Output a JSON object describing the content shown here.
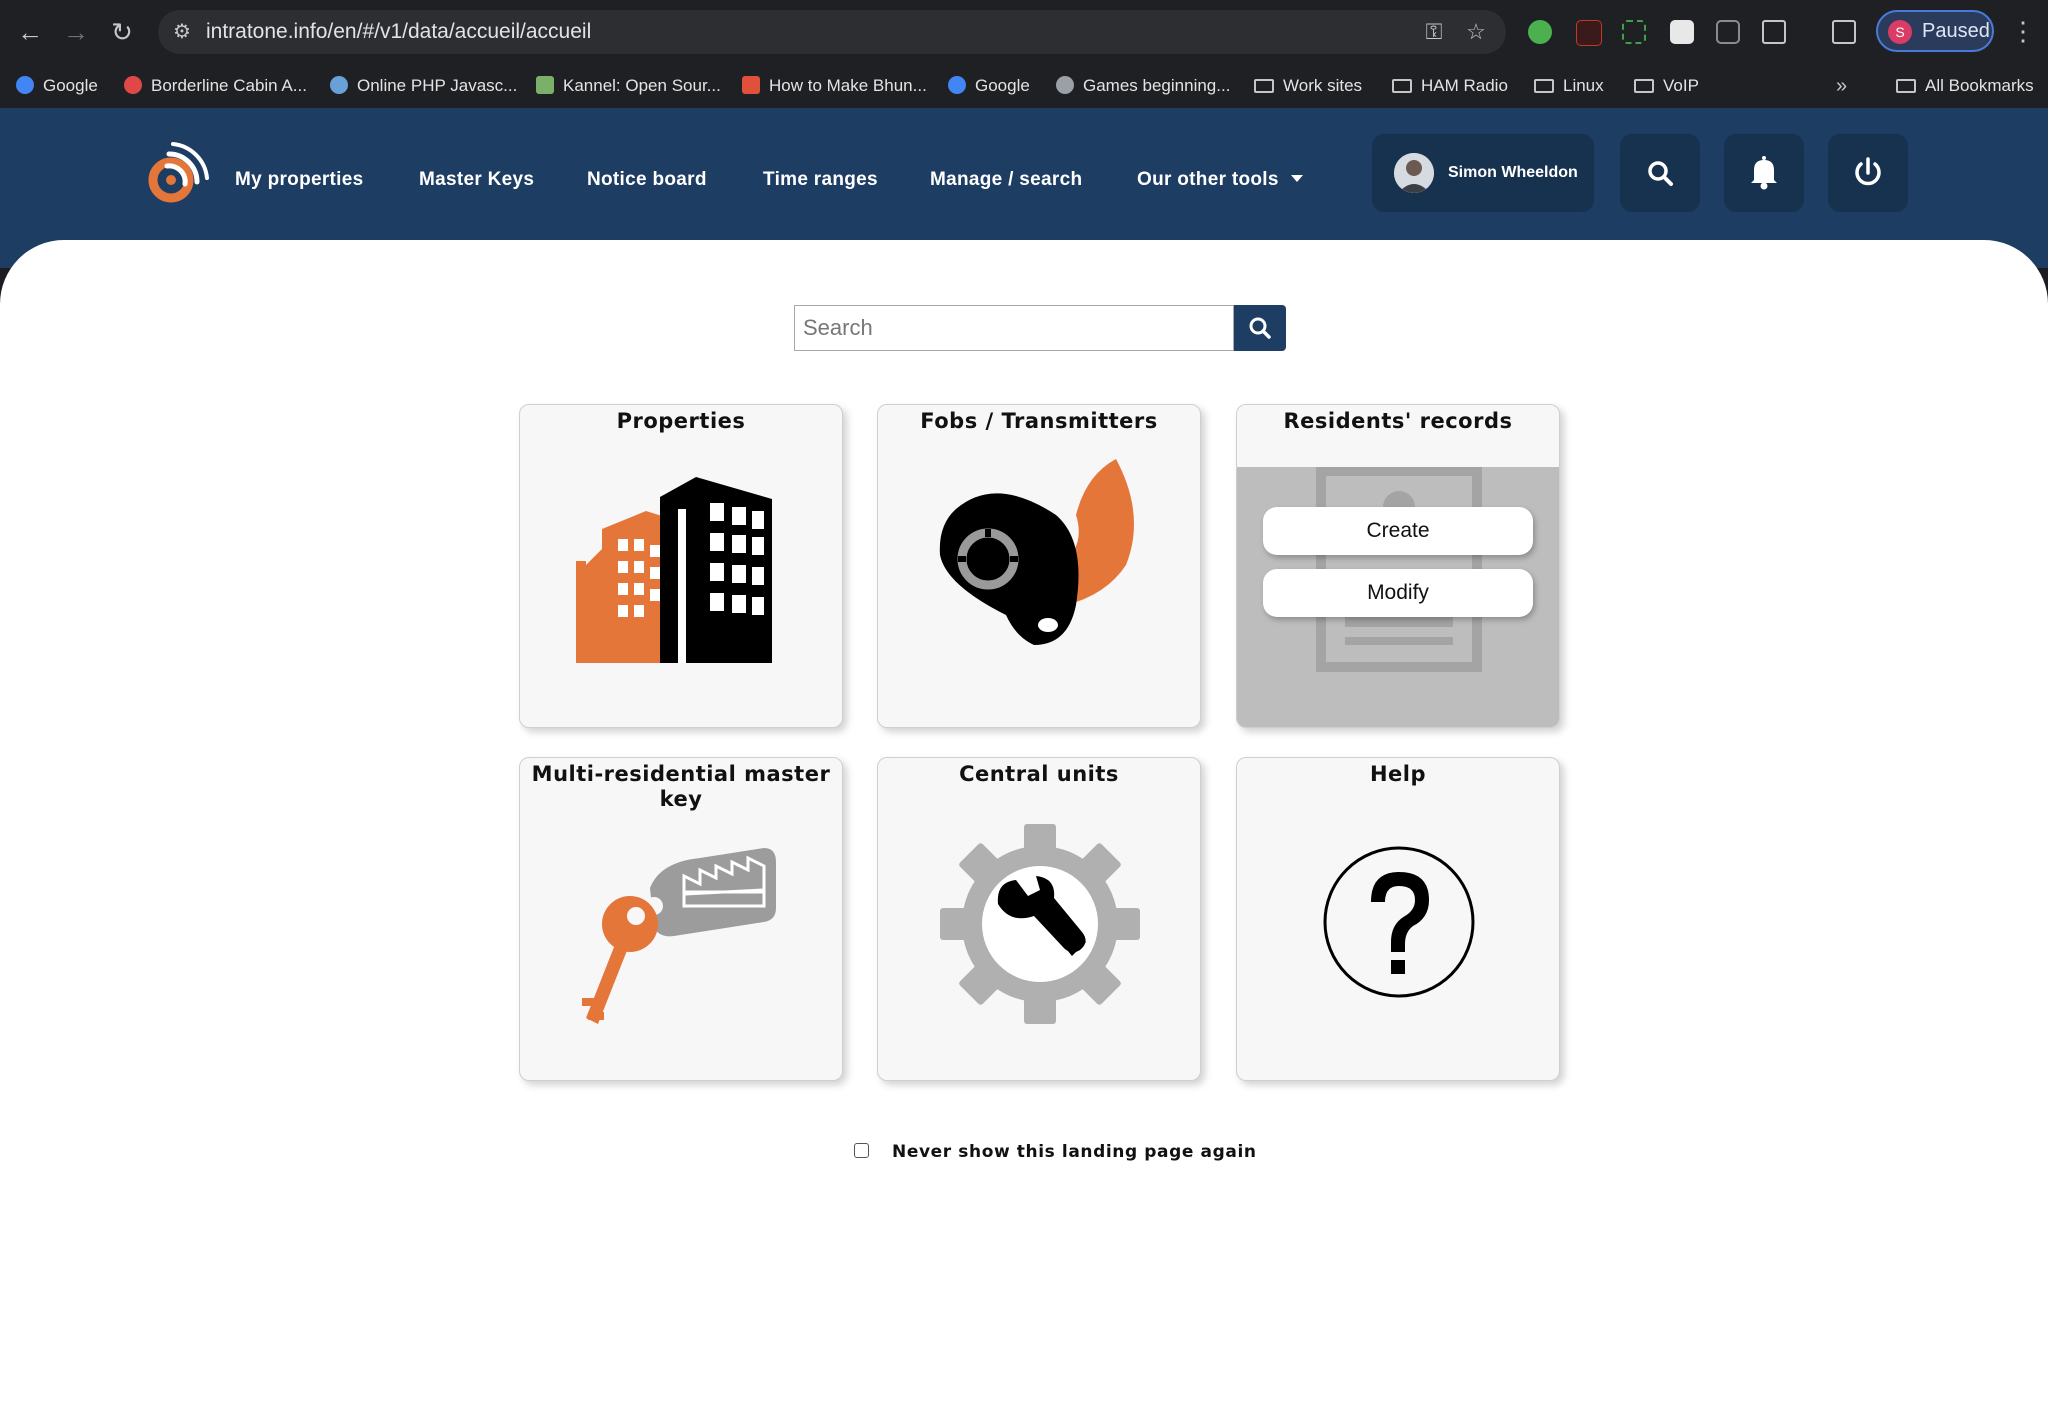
{
  "browser": {
    "url": "intratone.info/en/#/v1/data/accueil/accueil",
    "profile_initial": "S",
    "profile_status": "Paused",
    "bookmarks": [
      {
        "label": "Google",
        "icon": "google-icon",
        "color": "#4285f4"
      },
      {
        "label": "Borderline Cabin A...",
        "icon": "k-icon",
        "color": "#e04848"
      },
      {
        "label": "Online PHP Javasc...",
        "icon": "globe-icon",
        "color": "#6aa0d8"
      },
      {
        "label": "Kannel: Open Sour...",
        "icon": "kannel-icon",
        "color": "#7ab068"
      },
      {
        "label": "How to Make Bhun...",
        "icon": "recipe-icon",
        "color": "#e0503a"
      },
      {
        "label": "Google",
        "icon": "google-icon",
        "color": "#4285f4"
      },
      {
        "label": "Games beginning...",
        "icon": "globe-icon",
        "color": "#9aa0a6"
      },
      {
        "label": "Work sites",
        "icon": "folder-icon"
      },
      {
        "label": "HAM Radio",
        "icon": "folder-icon"
      },
      {
        "label": "Linux",
        "icon": "folder-icon"
      },
      {
        "label": "VoIP",
        "icon": "folder-icon"
      }
    ],
    "all_bookmarks": "All Bookmarks"
  },
  "header": {
    "nav": [
      "My properties",
      "Master Keys",
      "Notice board",
      "Time ranges",
      "Manage / search",
      "Our other tools"
    ],
    "user_name": "Simon Wheeldon",
    "colors": {
      "navy": "#1d3d63",
      "orange": "#e5763a"
    }
  },
  "search": {
    "placeholder": "Search"
  },
  "tiles": {
    "properties": "Properties",
    "fobs": "Fobs / Transmitters",
    "residents": "Residents' records",
    "create": "Create",
    "modify": "Modify",
    "master_key": "Multi-residential master key",
    "central_units": "Central units",
    "help": "Help"
  },
  "footer": {
    "never_show": "Never show this landing page again"
  }
}
